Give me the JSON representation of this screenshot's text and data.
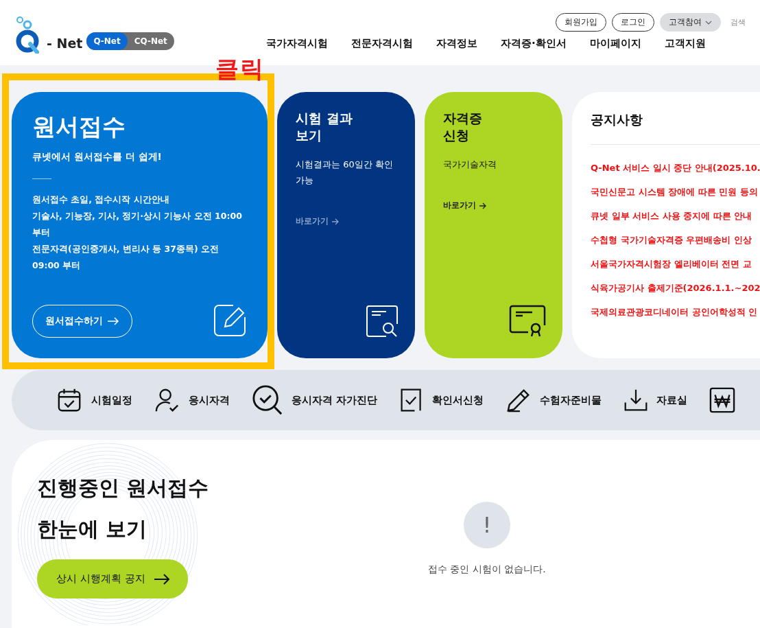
{
  "header": {
    "logo_text": "- Net",
    "site_toggle": [
      {
        "label": "Q-Net",
        "selected": true
      },
      {
        "label": "CQ-Net",
        "selected": false
      }
    ],
    "util_buttons": [
      {
        "label": "회원가입",
        "kind": "outline"
      },
      {
        "label": "로그인",
        "kind": "outline"
      },
      {
        "label": "고객참여",
        "kind": "dropdown"
      },
      {
        "label": "검색",
        "kind": "text"
      }
    ],
    "nav": [
      "국가자격시험",
      "전문자격시험",
      "자격정보",
      "자격증·확인서",
      "마이페이지",
      "고객지원"
    ]
  },
  "annotation": {
    "text": "클릭"
  },
  "cards": [
    {
      "kind": "primary",
      "title": "원서접수",
      "subtitle": "큐넷에서 원서접수를 더 쉽게!",
      "lines": [
        "원서접수 초일, 접수시작 시간안내",
        "기술사, 기능장, 기사, 정기·상시 기능사 오전 10:00 부터",
        "전문자격(공인중개사, 변리사 등 37종목) 오전 09:00 부터"
      ],
      "button": "원서접수하기"
    },
    {
      "kind": "dark",
      "title": "시험 결과 보기",
      "desc": "시험결과는 60일간 확인 가능",
      "link": "바로가기"
    },
    {
      "kind": "lime",
      "title": "자격증 신청",
      "desc": "국가기술자격",
      "link": "바로가기"
    }
  ],
  "notices": {
    "title": "공지사항",
    "items": [
      "Q-Net 서비스 일시 중단 안내(2025.10.",
      "국민신문고 시스템 장애에 따른 민원 등의",
      "큐넷 일부 서비스 사용 중지에 따른 안내",
      "수첩형 국가기술자격증 우편배송비 인상",
      "서울국가자격시험장 엘리베이터 전면 교",
      "식육가공기사 출제기준(2026.1.1.~202",
      "국제의료관광코디네이터 공인어학성적 인"
    ]
  },
  "quick_menu": [
    "시험일정",
    "응시자격",
    "응시자격 자가진단",
    "확인서신청",
    "수험자준비물",
    "자료실"
  ],
  "ongoing": {
    "title_lines": [
      "진행중인 원서접수",
      "한눈에 보기"
    ],
    "button": "상시 시행계획 공지",
    "empty_icon": "!",
    "empty_text": "접수 중인 시험이 없습니다."
  }
}
